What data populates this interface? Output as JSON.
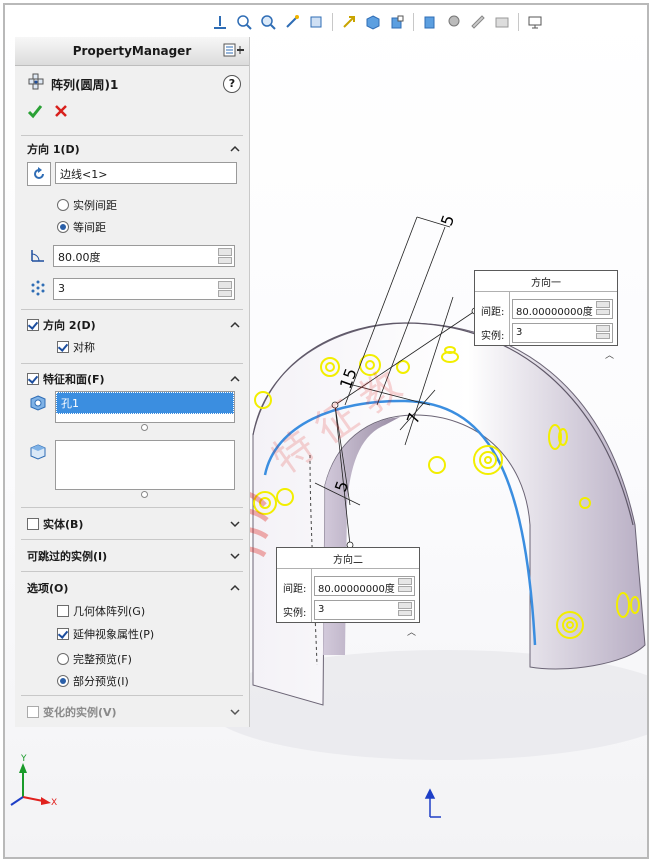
{
  "toolbar": {
    "icons": [
      "view-orientation-icon",
      "zoom-to-fit-icon",
      "zoom-to-area-icon",
      "previous-view-icon",
      "section-view-icon",
      "view-selector-icon",
      "display-style-icon",
      "hide-show-items-icon",
      "edit-appearance-icon",
      "apply-scene-icon",
      "view-settings-icon",
      "monitor-icon"
    ]
  },
  "property_manager": {
    "title": "PropertyManager",
    "feature_name": "阵列(圆周)1",
    "help_icon": "?",
    "direction1": {
      "title": "方向 1(D)",
      "axis_value": "边线<1>",
      "radio_instance_spacing": "实例间距",
      "radio_equal_spacing": "等间距",
      "angle_value": "80.00度",
      "instances_value": "3"
    },
    "direction2": {
      "title": "方向 2(D)",
      "symmetric_label": "对称"
    },
    "features_faces": {
      "title": "特征和面(F)",
      "features_item": "孔1"
    },
    "bodies": {
      "title": "实体(B)"
    },
    "skip_instances": {
      "title": "可跳过的实例(I)"
    },
    "options": {
      "title": "选项(O)",
      "geometry_pattern": "几何体阵列(G)",
      "propagate_visual": "延伸视象属性(P)",
      "full_preview": "完整预览(F)",
      "partial_preview": "部分预览(I)"
    },
    "varying_instances": {
      "title": "变化的实例(V)"
    }
  },
  "callout1": {
    "title": "方向一",
    "spacing_label": "间距:",
    "spacing_value": "80.00000000度",
    "instances_label": "实例:",
    "instances_value": "3"
  },
  "callout2": {
    "title": "方向二",
    "spacing_label": "间距:",
    "spacing_value": "80.00000000度",
    "instances_label": "实例:",
    "instances_value": "3"
  },
  "dimensions": {
    "d1": "5",
    "d2": "15",
    "d3": "7",
    "d4": "5"
  },
  "colors": {
    "accent_blue": "#3b8ee0",
    "hole_yellow": "#f2ee00",
    "arrow_red": "#e0211e",
    "part_body": "#e9e6ee"
  }
}
